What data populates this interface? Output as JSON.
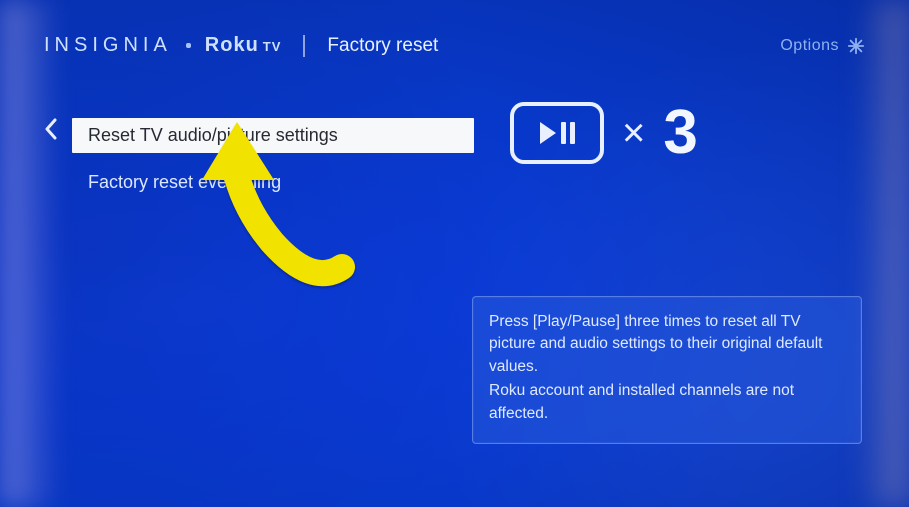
{
  "brand": {
    "name1": "INSIGNIA",
    "name2": "Roku",
    "name2_suffix": "TV"
  },
  "breadcrumb": "Factory reset",
  "options_label": "Options",
  "menu": {
    "items": [
      {
        "label": "Reset TV audio/picture settings",
        "selected": true
      },
      {
        "label": "Factory reset everything",
        "selected": false
      }
    ]
  },
  "action": {
    "multiplier_symbol": "×",
    "count": "3"
  },
  "info": {
    "line1": "Press [Play/Pause] three times to reset all TV picture and audio settings to their original default values.",
    "line2": "Roku account and installed channels are not affected."
  }
}
